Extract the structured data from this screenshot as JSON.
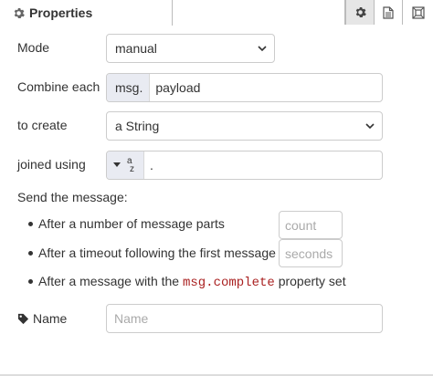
{
  "tabs": {
    "properties_label": "Properties",
    "icons": [
      "gear-icon",
      "document-icon",
      "frame-icon"
    ]
  },
  "form": {
    "mode": {
      "label": "Mode",
      "value": "manual"
    },
    "combine": {
      "label": "Combine each",
      "prefix": "msg.",
      "value": "payload"
    },
    "create": {
      "label": "to create",
      "value": "a String"
    },
    "joined": {
      "label": "joined using",
      "type_badge": "az",
      "value": "."
    },
    "send": {
      "heading": "Send the message:",
      "opt1": "After a number of message parts",
      "opt1_placeholder": "count",
      "opt2": "After a timeout following the first message",
      "opt2_placeholder": "seconds",
      "opt3_before": "After a message with the",
      "opt3_code": "msg.complete",
      "opt3_after": "property set"
    },
    "name": {
      "label": "Name",
      "placeholder": "Name"
    }
  },
  "colors": {
    "accent": "#e9ebf2",
    "code": "#aa2222"
  }
}
